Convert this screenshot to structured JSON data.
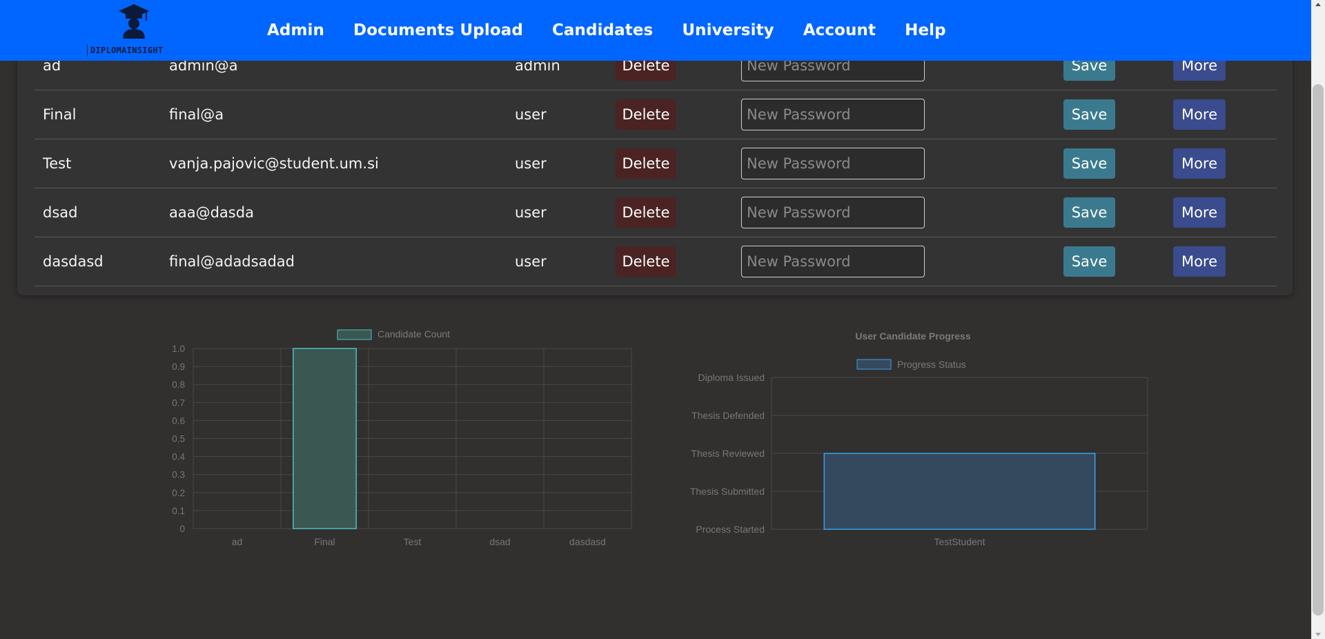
{
  "brand": {
    "logo_text": "DIPLOMAINSIGHT"
  },
  "nav": {
    "items": [
      "Admin",
      "Documents Upload",
      "Candidates",
      "University",
      "Account",
      "Help"
    ]
  },
  "users": {
    "password_placeholder": "New Password",
    "delete_label": "Delete",
    "save_label": "Save",
    "more_label": "More",
    "rows": [
      {
        "name": "ad",
        "email": "admin@a",
        "role": "admin"
      },
      {
        "name": "Final",
        "email": "final@a",
        "role": "user"
      },
      {
        "name": "Test",
        "email": "vanja.pajovic@student.um.si",
        "role": "user"
      },
      {
        "name": "dsad",
        "email": "aaa@dasda",
        "role": "user"
      },
      {
        "name": "dasdasd",
        "email": "final@adadsadad",
        "role": "user"
      }
    ]
  },
  "chart_data": [
    {
      "type": "bar",
      "title": "",
      "legend": "Candidate Count",
      "categories": [
        "ad",
        "Final",
        "Test",
        "dsad",
        "dasdasd"
      ],
      "values": [
        0,
        1,
        0,
        0,
        0
      ],
      "yticks": [
        "1.0",
        "0.9",
        "0.8",
        "0.7",
        "0.6",
        "0.5",
        "0.4",
        "0.3",
        "0.2",
        "0.1",
        "0"
      ],
      "ylim": [
        0,
        1
      ],
      "grid": true,
      "colors": {
        "fill": "#3a5752",
        "stroke": "#4bc0c0"
      }
    },
    {
      "type": "bar",
      "title": "User Candidate Progress",
      "legend": "Progress Status",
      "categories": [
        "TestStudent"
      ],
      "values": [
        "Thesis Reviewed"
      ],
      "yticks": [
        "Diploma Issued",
        "Thesis Defended",
        "Thesis Reviewed",
        "Thesis Submitted",
        "Process Started"
      ],
      "grid": true,
      "colors": {
        "fill": "#35495e",
        "stroke": "#36a2eb"
      }
    }
  ]
}
